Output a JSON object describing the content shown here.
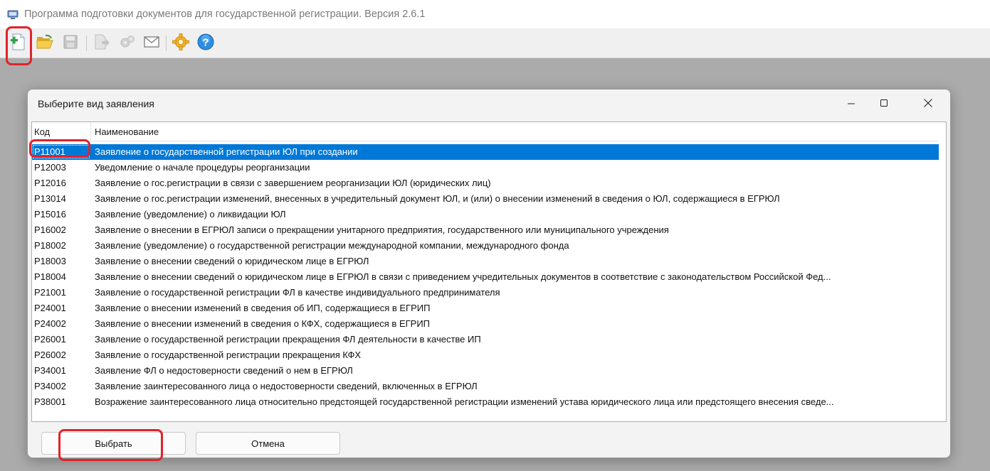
{
  "app": {
    "title": "Программа подготовки документов для государственной регистрации. Версия 2.6.1",
    "icon": "computer-icon"
  },
  "toolbar": {
    "buttons": [
      {
        "icon": "new-document-icon",
        "enabled": true
      },
      {
        "icon": "open-folder-icon",
        "enabled": true
      },
      {
        "icon": "save-disk-icon",
        "enabled": false
      },
      {
        "icon": "export-document-icon",
        "enabled": false
      },
      {
        "icon": "send-gears-icon",
        "enabled": false
      },
      {
        "icon": "envelope-icon",
        "enabled": true
      },
      {
        "icon": "settings-gear-icon",
        "enabled": true
      },
      {
        "icon": "help-icon",
        "enabled": true
      }
    ]
  },
  "dialog": {
    "title": "Выберите вид заявления",
    "controls": {
      "minimize": "—",
      "maximize": "☐",
      "close": "✕"
    },
    "columns": {
      "code": "Код",
      "name": "Наименование"
    },
    "selected_index": 0,
    "rows": [
      {
        "code": "P11001",
        "name": "Заявление о государственной регистрации ЮЛ при создании"
      },
      {
        "code": "P12003",
        "name": "Уведомление о начале процедуры реорганизации"
      },
      {
        "code": "P12016",
        "name": "Заявление о гос.регистрации в связи с завершением реорганизации ЮЛ (юридических лиц)"
      },
      {
        "code": "P13014",
        "name": "Заявление о гос.регистрации изменений, внесенных в учредительный документ ЮЛ, и (или) о внесении изменений в сведения о ЮЛ, содержащиеся в ЕГРЮЛ"
      },
      {
        "code": "P15016",
        "name": "Заявление (уведомление) о ликвидации ЮЛ"
      },
      {
        "code": "P16002",
        "name": "Заявление о внесении в ЕГРЮЛ записи о прекращении унитарного предприятия, государственного или муниципального учреждения"
      },
      {
        "code": "P18002",
        "name": "Заявление (уведомление) о государственной регистрации международной компании, международного фонда"
      },
      {
        "code": "P18003",
        "name": "Заявление о внесении сведений о юридическом лице в ЕГРЮЛ"
      },
      {
        "code": "P18004",
        "name": "Заявление о внесении сведений о юридическом лице в ЕГРЮЛ в связи с приведением учредительных документов в соответствие с законодательством Российской Фед..."
      },
      {
        "code": "P21001",
        "name": "Заявление о государственной регистрации ФЛ в качестве индивидуального предпринимателя"
      },
      {
        "code": "P24001",
        "name": "Заявление о внесении изменений в сведения об ИП, содержащиеся в ЕГРИП"
      },
      {
        "code": "P24002",
        "name": "Заявление о внесении изменений в сведения о КФХ, содержащиеся в ЕГРИП"
      },
      {
        "code": "P26001",
        "name": "Заявление о государственной регистрации прекращения ФЛ деятельности в качестве ИП"
      },
      {
        "code": "P26002",
        "name": "Заявление о государственной регистрации прекращения КФХ"
      },
      {
        "code": "P34001",
        "name": "Заявление ФЛ о недостоверности сведений о нем в ЕГРЮЛ"
      },
      {
        "code": "P34002",
        "name": "Заявление заинтересованного лица о недостоверности сведений, включенных в ЕГРЮЛ"
      },
      {
        "code": "P38001",
        "name": "Возражение заинтересованного лица относительно предстоящей государственной регистрации изменений устава юридического лица или предстоящего внесения сведе..."
      }
    ],
    "buttons": {
      "select": "Выбрать",
      "cancel": "Отмена"
    }
  },
  "colors": {
    "selection": "#0078d7",
    "annotation": "#e0232b",
    "backdrop": "#ababab"
  }
}
